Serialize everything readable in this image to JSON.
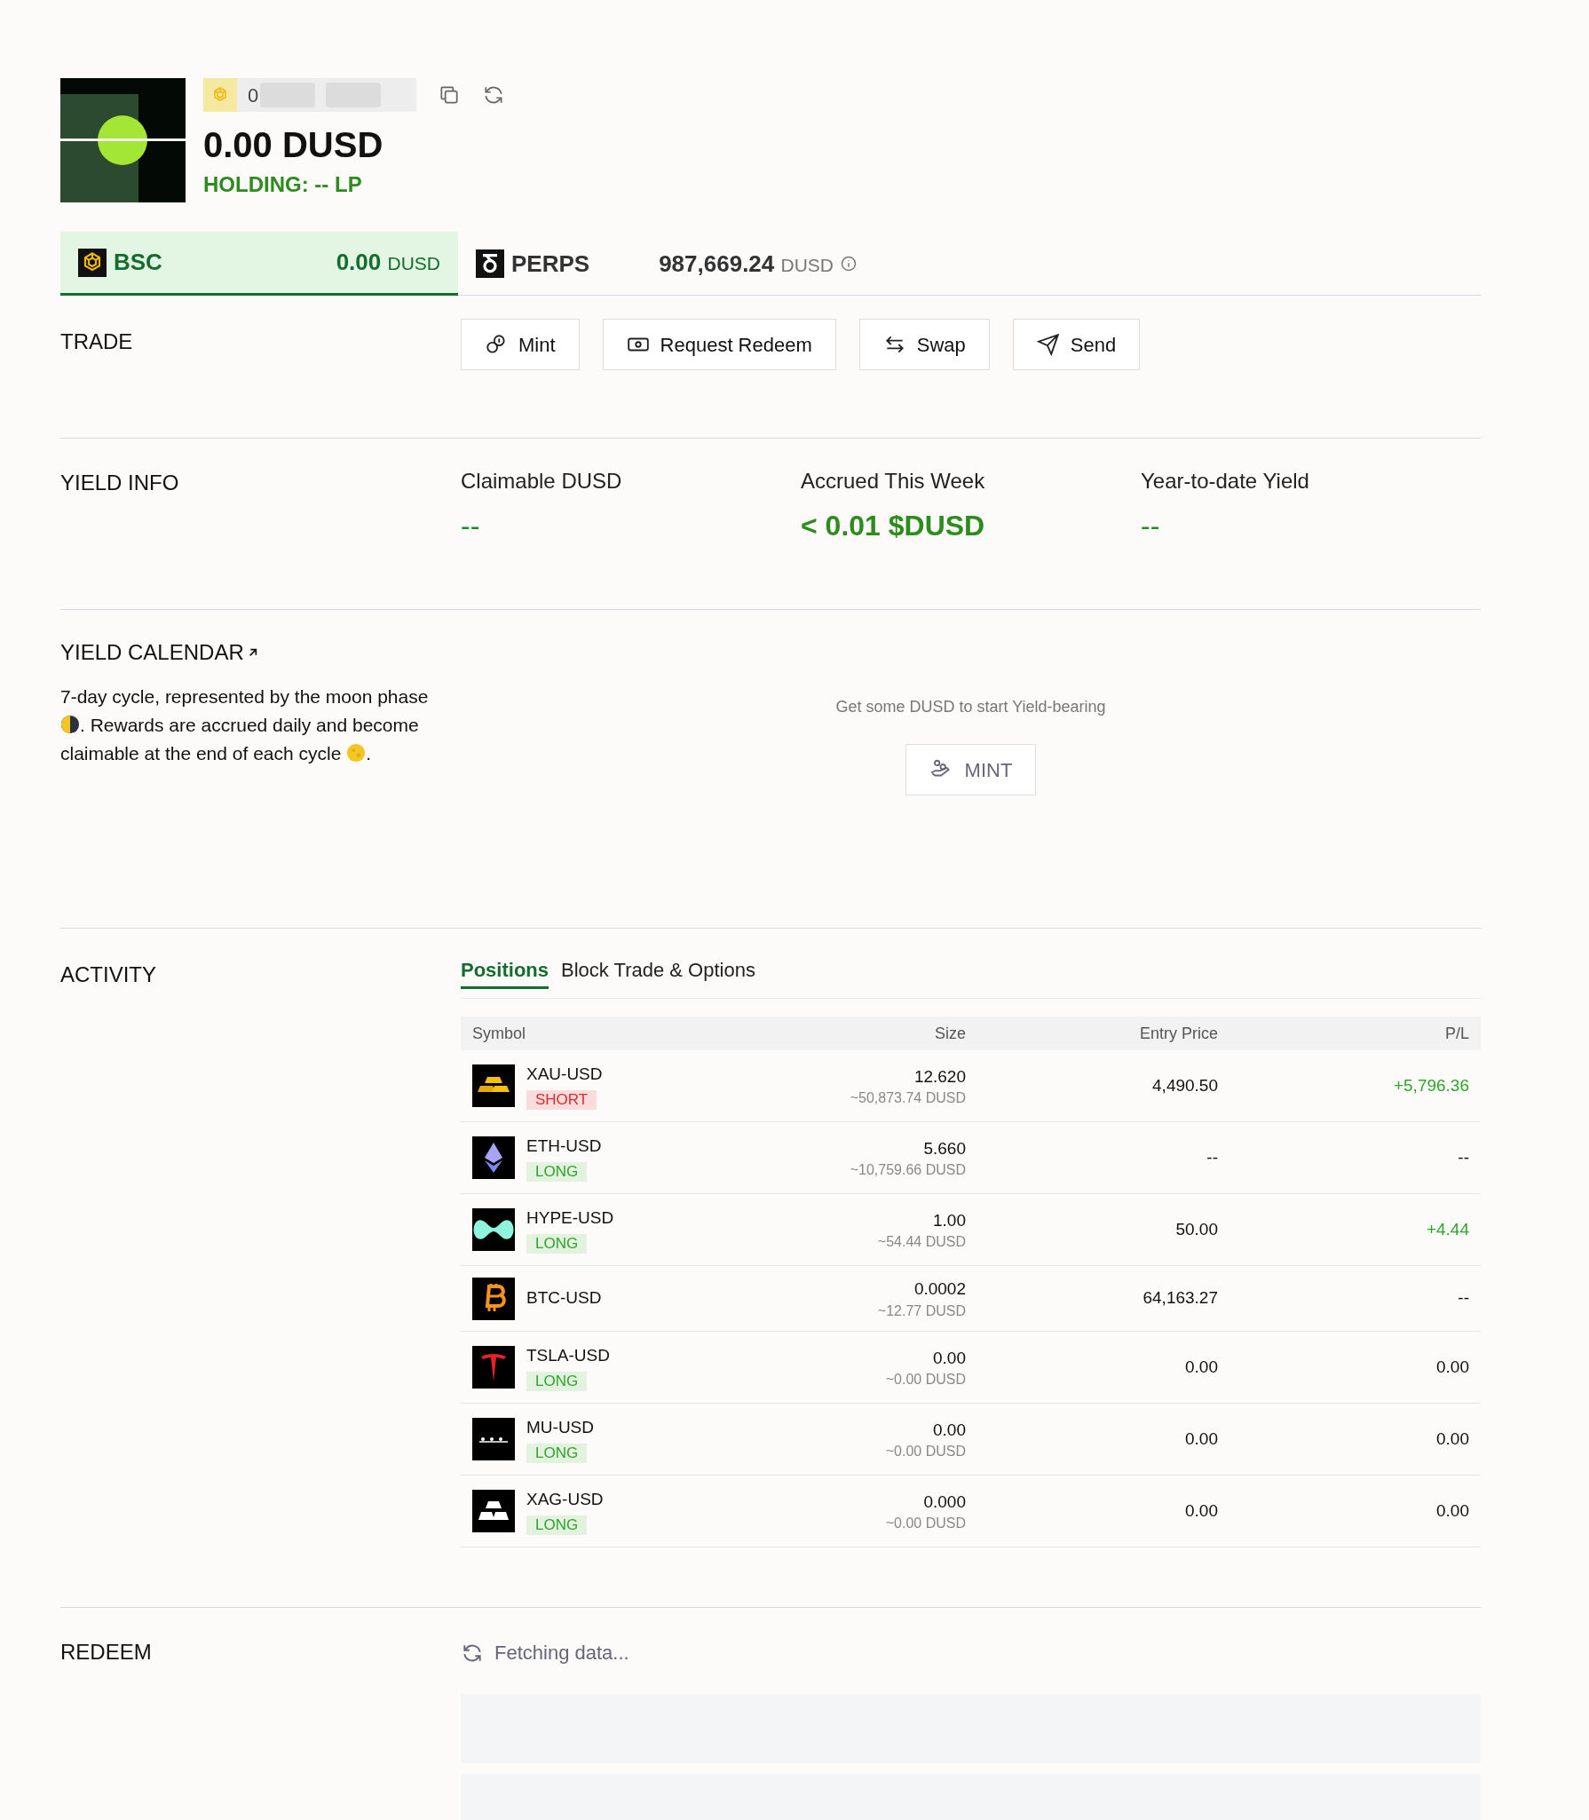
{
  "account": {
    "address_start": "0",
    "balance": "0.00 DUSD",
    "holding": "HOLDING: -- LP"
  },
  "chains": [
    {
      "label": "BSC",
      "value": "0.00",
      "unit": "DUSD",
      "selected": true,
      "info": false
    },
    {
      "label": "PERPS",
      "value": "987,669.24",
      "unit": "DUSD",
      "selected": false,
      "info": true
    }
  ],
  "trade": {
    "title": "TRADE",
    "buttons": [
      "Mint",
      "Request Redeem",
      "Swap",
      "Send"
    ]
  },
  "yield_info": {
    "title": "YIELD INFO",
    "stats": [
      {
        "label": "Claimable DUSD",
        "value": "--",
        "highlight": false
      },
      {
        "label": "Accrued This Week",
        "value": "< 0.01 $DUSD",
        "highlight": true
      },
      {
        "label": "Year-to-date Yield",
        "value": "--",
        "highlight": false
      }
    ]
  },
  "yield_calendar": {
    "title": "YIELD CALENDAR",
    "text_parts": [
      "7-day cycle, represented by the moon phase",
      ". Rewards are accrued daily and become claimable at the end of each cycle",
      "."
    ],
    "empty_text": "Get some DUSD to start Yield-bearing",
    "button": "MINT"
  },
  "activity": {
    "title": "ACTIVITY",
    "tabs": [
      {
        "label": "Positions",
        "selected": true
      },
      {
        "label": "Block Trade & Options",
        "selected": false
      }
    ],
    "columns": [
      "Symbol",
      "Size",
      "Entry Price",
      "P/L"
    ],
    "rows": [
      {
        "symbol": "XAU-USD",
        "side": "SHORT",
        "short": true,
        "size": "12.620",
        "size_value": "~50,873.74 DUSD",
        "entry": "4,490.50",
        "pl": "+5,796.36",
        "pl_positive": true
      },
      {
        "symbol": "ETH-USD",
        "side": "LONG",
        "short": false,
        "size": "5.660",
        "size_value": "~10,759.66 DUSD",
        "entry": "--",
        "pl": "--",
        "pl_positive": false
      },
      {
        "symbol": "HYPE-USD",
        "side": "LONG",
        "short": false,
        "size": "1.00",
        "size_value": "~54.44 DUSD",
        "entry": "50.00",
        "pl": "+4.44",
        "pl_positive": true
      },
      {
        "symbol": "BTC-USD",
        "size": "0.0002",
        "size_value": "~12.77 DUSD",
        "entry": "64,163.27",
        "pl": "--",
        "pl_positive": false
      },
      {
        "symbol": "TSLA-USD",
        "side": "LONG",
        "short": false,
        "size": "0.00",
        "size_value": "~0.00 DUSD",
        "entry": "0.00",
        "pl": "0.00",
        "pl_positive": false
      },
      {
        "symbol": "MU-USD",
        "side": "LONG",
        "short": false,
        "size": "0.00",
        "size_value": "~0.00 DUSD",
        "entry": "0.00",
        "pl": "0.00",
        "pl_positive": false
      },
      {
        "symbol": "XAG-USD",
        "side": "LONG",
        "short": false,
        "size": "0.000",
        "size_value": "~0.00 DUSD",
        "entry": "0.00",
        "pl": "0.00",
        "pl_positive": false
      }
    ]
  },
  "redeem": {
    "title": "REDEEM",
    "status": "Fetching data..."
  }
}
